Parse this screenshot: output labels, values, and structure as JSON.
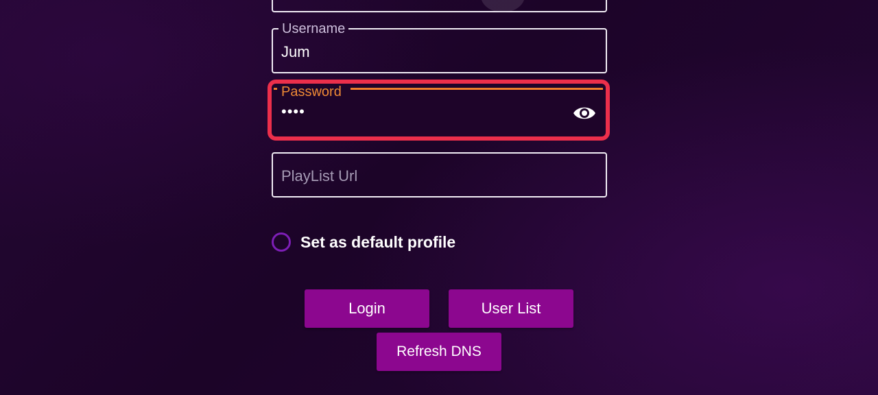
{
  "form": {
    "username": {
      "label": "Username",
      "value": "Jum"
    },
    "password": {
      "label": "Password",
      "masked_value": "••••"
    },
    "playlist_url": {
      "placeholder": "PlayList Url"
    },
    "default_profile": {
      "label": "Set as default profile",
      "checked": false
    }
  },
  "buttons": {
    "login": "Login",
    "user_list": "User List",
    "refresh_dns": "Refresh DNS"
  },
  "icons": {
    "password_toggle": "eye-icon"
  },
  "colors": {
    "background": "#1e0429",
    "button": "#8c078f",
    "focus_label": "#ef8a35",
    "highlight_border": "#ec2f4b",
    "radio_border": "#7d1eb6"
  }
}
